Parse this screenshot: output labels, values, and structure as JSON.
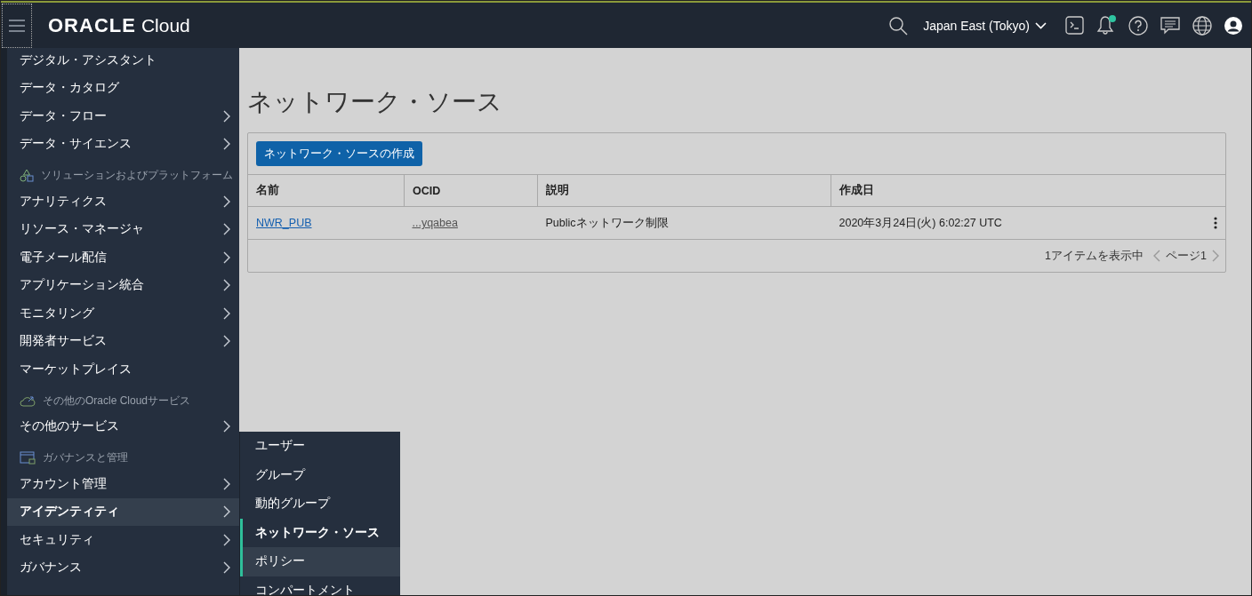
{
  "header": {
    "logo_brand": "ORACLE",
    "logo_product": "Cloud",
    "region": "Japan East (Tokyo)",
    "notification": true
  },
  "sidebar": {
    "items": [
      {
        "kind": "item",
        "label": "デジタル・アシスタント",
        "has_submenu": false,
        "selected": false
      },
      {
        "kind": "item",
        "label": "データ・カタログ",
        "has_submenu": false,
        "selected": false
      },
      {
        "kind": "item",
        "label": "データ・フロー",
        "has_submenu": true,
        "selected": false
      },
      {
        "kind": "item",
        "label": "データ・サイエンス",
        "has_submenu": true,
        "selected": false
      },
      {
        "kind": "section",
        "label": "ソリューションおよびプラットフォーム"
      },
      {
        "kind": "item",
        "label": "アナリティクス",
        "has_submenu": true,
        "selected": false
      },
      {
        "kind": "item",
        "label": "リソース・マネージャ",
        "has_submenu": true,
        "selected": false
      },
      {
        "kind": "item",
        "label": "電子メール配信",
        "has_submenu": true,
        "selected": false
      },
      {
        "kind": "item",
        "label": "アプリケーション統合",
        "has_submenu": true,
        "selected": false
      },
      {
        "kind": "item",
        "label": "モニタリング",
        "has_submenu": true,
        "selected": false
      },
      {
        "kind": "item",
        "label": "開発者サービス",
        "has_submenu": true,
        "selected": false
      },
      {
        "kind": "item",
        "label": "マーケットプレイス",
        "has_submenu": false,
        "selected": false
      },
      {
        "kind": "section",
        "label": "その他のOracle Cloudサービス"
      },
      {
        "kind": "item",
        "label": "その他のサービス",
        "has_submenu": true,
        "selected": false
      },
      {
        "kind": "section",
        "label": "ガバナンスと管理"
      },
      {
        "kind": "item",
        "label": "アカウント管理",
        "has_submenu": true,
        "selected": false
      },
      {
        "kind": "item",
        "label": "アイデンティティ",
        "has_submenu": true,
        "selected": true
      },
      {
        "kind": "item",
        "label": "セキュリティ",
        "has_submenu": true,
        "selected": false
      },
      {
        "kind": "item",
        "label": "ガバナンス",
        "has_submenu": true,
        "selected": false
      }
    ]
  },
  "submenu": {
    "items": [
      {
        "label": "ユーザー",
        "selected": false,
        "hovered": false
      },
      {
        "label": "グループ",
        "selected": false,
        "hovered": false
      },
      {
        "label": "動的グループ",
        "selected": false,
        "hovered": false
      },
      {
        "label": "ネットワーク・ソース",
        "selected": true,
        "hovered": false
      },
      {
        "label": "ポリシー",
        "selected": false,
        "hovered": true
      },
      {
        "label": "コンパートメント",
        "selected": false,
        "hovered": false
      }
    ]
  },
  "page": {
    "title": "ネットワーク・ソース",
    "create_button": "ネットワーク・ソースの作成",
    "table": {
      "columns": [
        "名前",
        "OCID",
        "説明",
        "作成日"
      ],
      "rows": [
        {
          "name": "NWR_PUB",
          "ocid": "...yqabea",
          "description": "Publicネットワーク制限",
          "created": "2020年3月24日(火) 6:02:27 UTC"
        }
      ]
    },
    "footer": {
      "count": "1アイテムを表示中",
      "page": "ページ1"
    }
  }
}
